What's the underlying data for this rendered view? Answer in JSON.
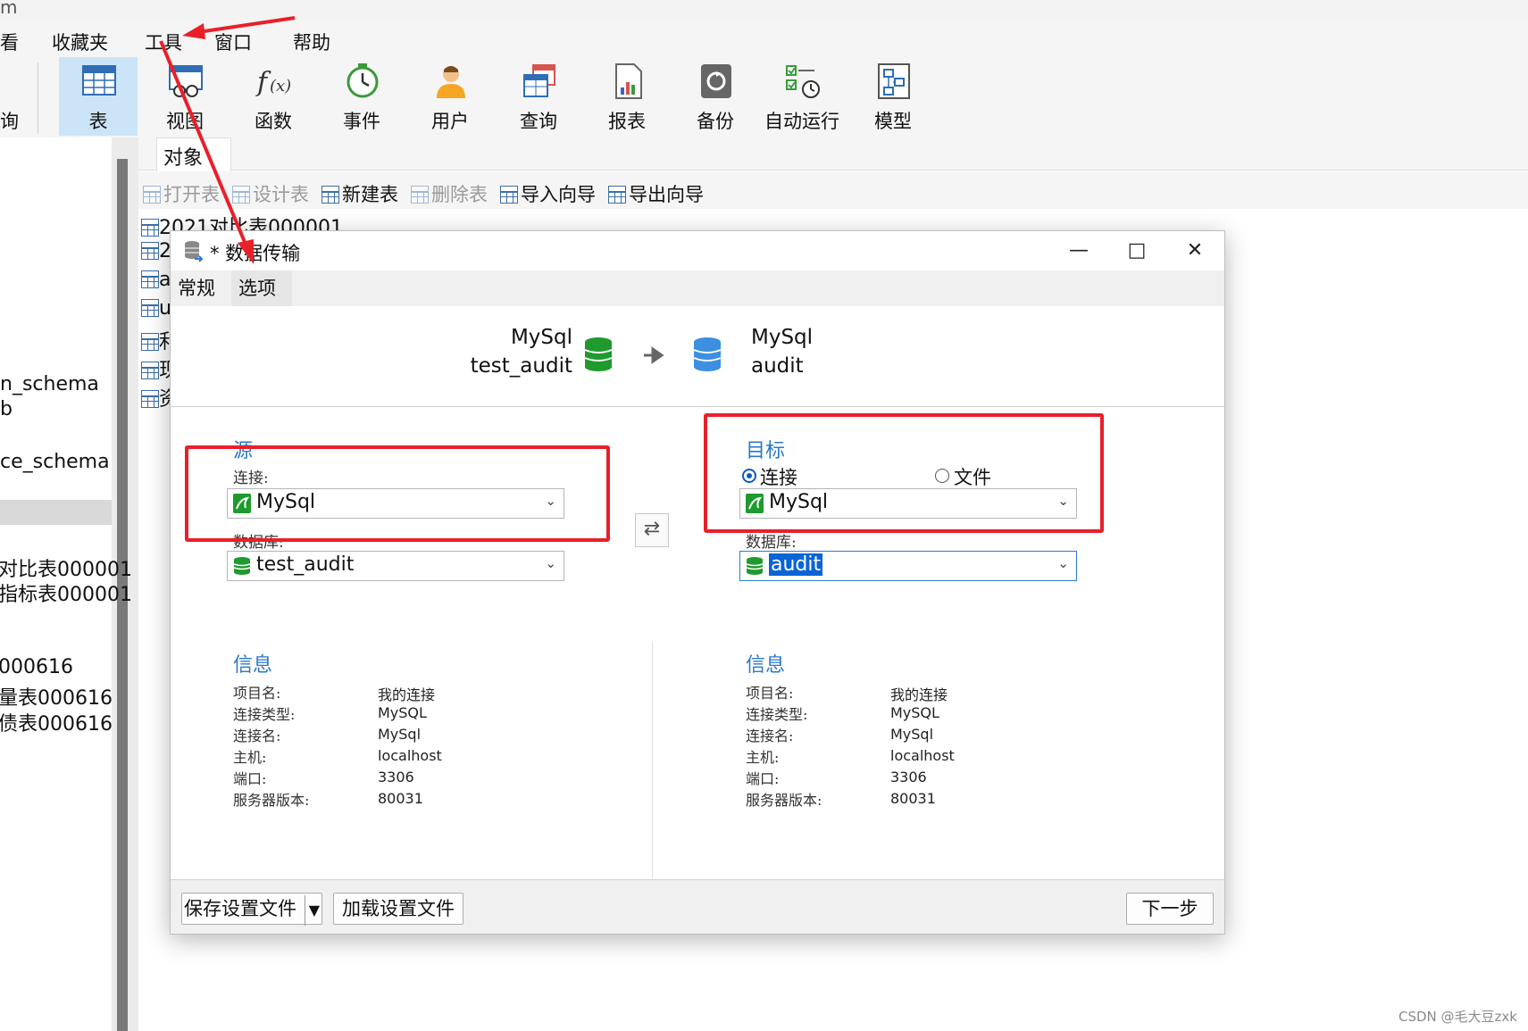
{
  "window": {
    "title_fragment": "m"
  },
  "menubar": {
    "items": [
      "看",
      "收藏夹",
      "工具",
      "窗口",
      "帮助"
    ]
  },
  "ribbon": {
    "left_fragment": "询",
    "buttons": [
      {
        "label": "表",
        "icon": "table-icon",
        "active": true
      },
      {
        "label": "视图",
        "icon": "view-icon"
      },
      {
        "label": "函数",
        "icon": "function-icon"
      },
      {
        "label": "事件",
        "icon": "event-clock-icon"
      },
      {
        "label": "用户",
        "icon": "user-icon"
      },
      {
        "label": "查询",
        "icon": "query-icon"
      },
      {
        "label": "报表",
        "icon": "report-icon"
      },
      {
        "label": "备份",
        "icon": "backup-icon"
      },
      {
        "label": "自动运行",
        "icon": "automation-icon"
      },
      {
        "label": "模型",
        "icon": "model-icon"
      }
    ]
  },
  "leftnav": {
    "items": [
      "n_schema",
      "b",
      "ce_schema",
      "对比表000001",
      "指标表000001",
      "000616",
      "量表000616",
      "债表000616"
    ]
  },
  "objects": {
    "tab_label": "对象",
    "toolbar": {
      "open_table": "打开表",
      "design_table": "设计表",
      "new_table": "新建表",
      "delete_table": "删除表",
      "import_wizard": "导入向导",
      "export_wizard": "导出向导"
    },
    "rows": [
      "2021对比表000001",
      "2",
      "a",
      "u",
      "利",
      "现",
      "资"
    ]
  },
  "dialog": {
    "title": "* 数据传输",
    "tabs": {
      "general": "常规",
      "options": "选项"
    },
    "header": {
      "source_type": "MySql",
      "source_db": "test_audit",
      "target_type": "MySql",
      "target_db": "audit"
    },
    "source": {
      "section_title": "源",
      "connection_label": "连接:",
      "connection_value": "MySql",
      "database_label": "数据库:",
      "database_value": "test_audit"
    },
    "target": {
      "section_title": "目标",
      "radio_connection": "连接",
      "radio_file": "文件",
      "connection_value": "MySql",
      "database_label": "数据库:",
      "database_value": "audit"
    },
    "source_info": {
      "title": "信息",
      "rows": [
        {
          "k": "项目名:",
          "v": "我的连接"
        },
        {
          "k": "连接类型:",
          "v": "MySQL"
        },
        {
          "k": "连接名:",
          "v": "MySql"
        },
        {
          "k": "主机:",
          "v": "localhost"
        },
        {
          "k": "端口:",
          "v": "3306"
        },
        {
          "k": "服务器版本:",
          "v": "80031"
        }
      ]
    },
    "target_info": {
      "title": "信息",
      "rows": [
        {
          "k": "项目名:",
          "v": "我的连接"
        },
        {
          "k": "连接类型:",
          "v": "MySQL"
        },
        {
          "k": "连接名:",
          "v": "MySql"
        },
        {
          "k": "主机:",
          "v": "localhost"
        },
        {
          "k": "端口:",
          "v": "3306"
        },
        {
          "k": "服务器版本:",
          "v": "80031"
        }
      ]
    },
    "footer": {
      "save_profile": "保存设置文件",
      "load_profile": "加载设置文件",
      "next": "下一步"
    }
  },
  "annotations": {
    "accent_red": "#e8202a"
  },
  "watermark": "CSDN @毛大豆zxk"
}
